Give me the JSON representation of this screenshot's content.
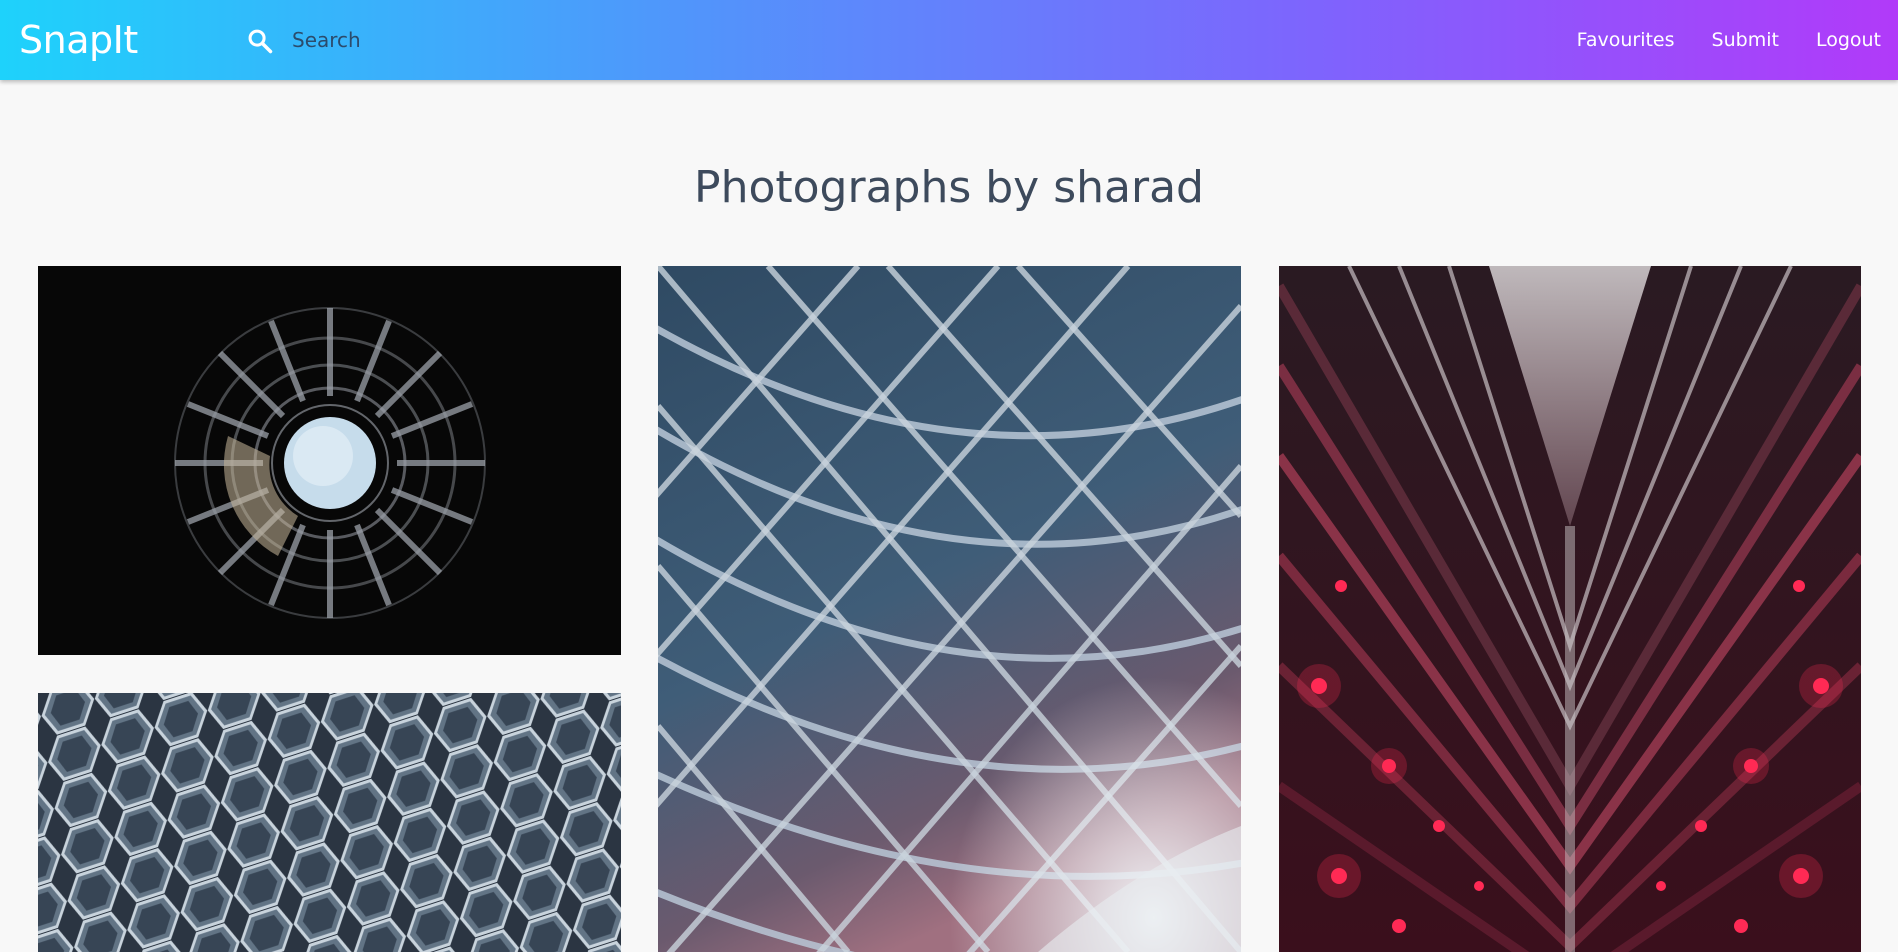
{
  "navbar": {
    "brand": "SnapIt",
    "search": {
      "placeholder": "Search",
      "value": ""
    },
    "links": [
      "Favourites",
      "Submit",
      "Logout"
    ]
  },
  "page": {
    "title": "Photographs by sharad"
  },
  "gallery": {
    "photos": [
      {
        "id": "photo-1",
        "subject": "spiral-stairwell-sky"
      },
      {
        "id": "photo-2",
        "subject": "hexagon-facade"
      },
      {
        "id": "photo-3",
        "subject": "lattice-roof"
      },
      {
        "id": "photo-4",
        "subject": "red-atrium"
      }
    ]
  },
  "colors": {
    "gradient_start": "#1ed2fb",
    "gradient_end": "#b13af9",
    "title_text": "#3d4a5c",
    "background": "#f8f8f8"
  },
  "icons": {
    "search": "search-icon"
  }
}
